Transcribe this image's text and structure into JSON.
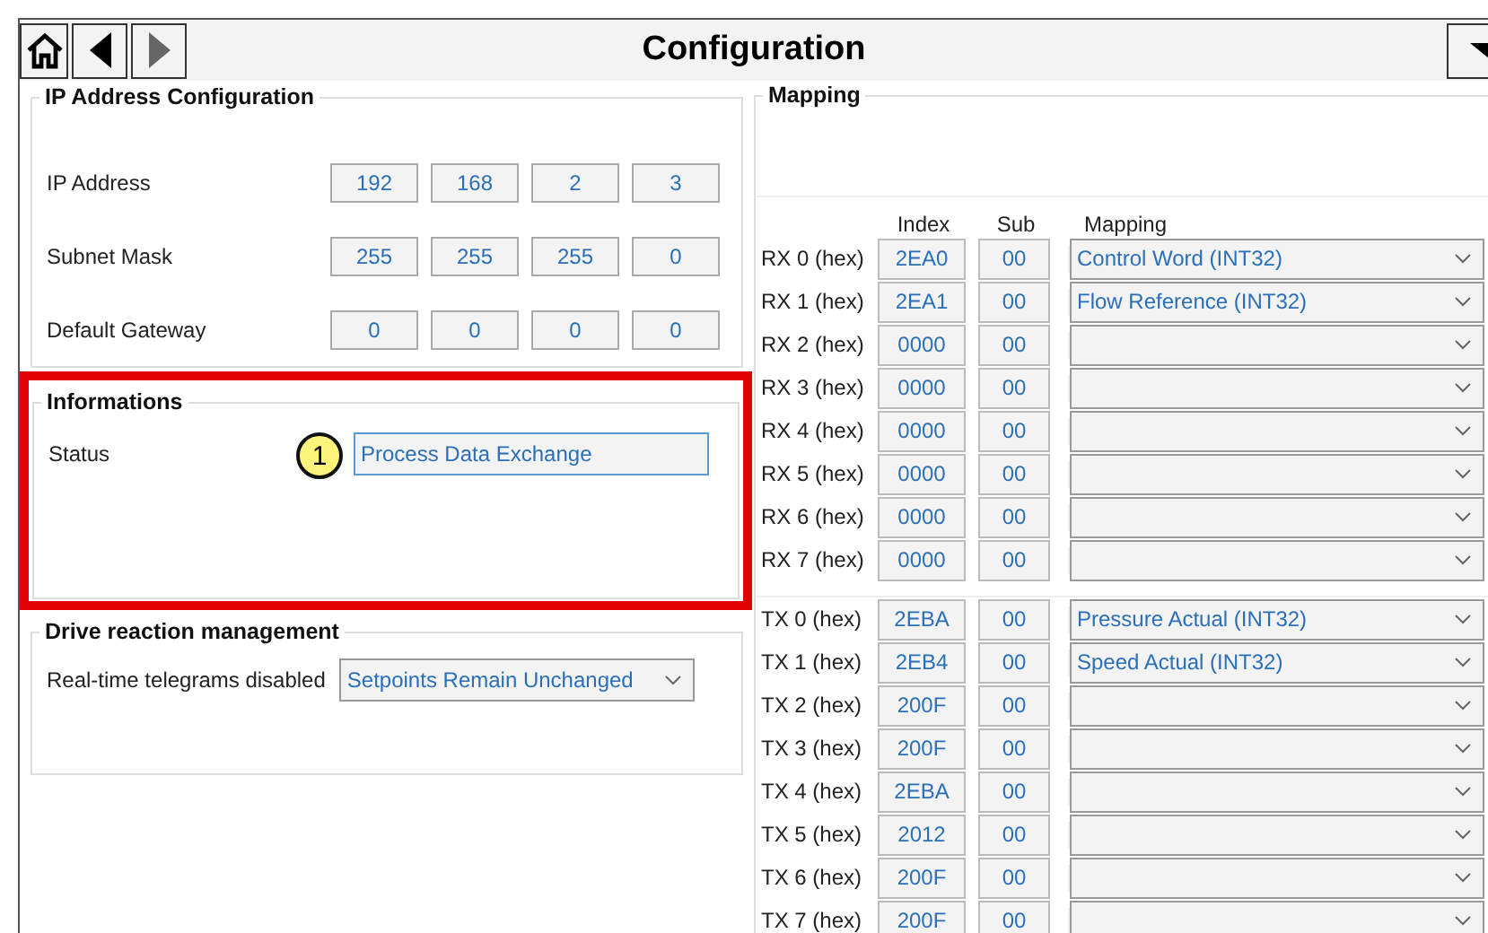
{
  "toolbar": {
    "title": "Configuration",
    "nav": [
      {
        "kind": "home",
        "disabled": false
      },
      {
        "kind": "back",
        "disabled": false
      },
      {
        "kind": "forward",
        "disabled": true
      }
    ]
  },
  "ip_config": {
    "title": "IP Address Configuration",
    "rows": [
      {
        "label": "IP Address",
        "octets": [
          "192",
          "168",
          "2",
          "3"
        ]
      },
      {
        "label": "Subnet Mask",
        "octets": [
          "255",
          "255",
          "255",
          "0"
        ]
      },
      {
        "label": "Default Gateway",
        "octets": [
          "0",
          "0",
          "0",
          "0"
        ]
      }
    ]
  },
  "informations": {
    "title": "Informations",
    "status_label": "Status",
    "callout": "1",
    "status": "Process Data Exchange"
  },
  "drive_reaction": {
    "title": "Drive reaction management",
    "label": "Real-time telegrams disabled",
    "value": "Setpoints Remain Unchanged"
  },
  "mapping": {
    "title": "Mapping",
    "columns": [
      "Index",
      "Sub",
      "Mapping"
    ],
    "rx": [
      {
        "label": "RX 0 (hex)",
        "index": "2EA0",
        "sub": "00",
        "mapping": "Control Word (INT32)"
      },
      {
        "label": "RX 1 (hex)",
        "index": "2EA1",
        "sub": "00",
        "mapping": "Flow Reference (INT32)"
      },
      {
        "label": "RX 2 (hex)",
        "index": "0000",
        "sub": "00"
      },
      {
        "label": "RX 3 (hex)",
        "index": "0000",
        "sub": "00"
      },
      {
        "label": "RX 4 (hex)",
        "index": "0000",
        "sub": "00"
      },
      {
        "label": "RX 5 (hex)",
        "index": "0000",
        "sub": "00"
      },
      {
        "label": "RX 6 (hex)",
        "index": "0000",
        "sub": "00"
      },
      {
        "label": "RX 7 (hex)",
        "index": "0000",
        "sub": "00"
      }
    ],
    "tx": [
      {
        "label": "TX 0 (hex)",
        "index": "2EBA",
        "sub": "00",
        "mapping": "Pressure Actual (INT32)"
      },
      {
        "label": "TX 1 (hex)",
        "index": "2EB4",
        "sub": "00",
        "mapping": "Speed Actual (INT32)"
      },
      {
        "label": "TX 2 (hex)",
        "index": "200F",
        "sub": "00"
      },
      {
        "label": "TX 3 (hex)",
        "index": "200F",
        "sub": "00"
      },
      {
        "label": "TX 4 (hex)",
        "index": "2EBA",
        "sub": "00"
      },
      {
        "label": "TX 5 (hex)",
        "index": "2012",
        "sub": "00"
      },
      {
        "label": "TX 6 (hex)",
        "index": "200F",
        "sub": "00"
      },
      {
        "label": "TX 7 (hex)",
        "index": "200F",
        "sub": "00"
      }
    ]
  }
}
